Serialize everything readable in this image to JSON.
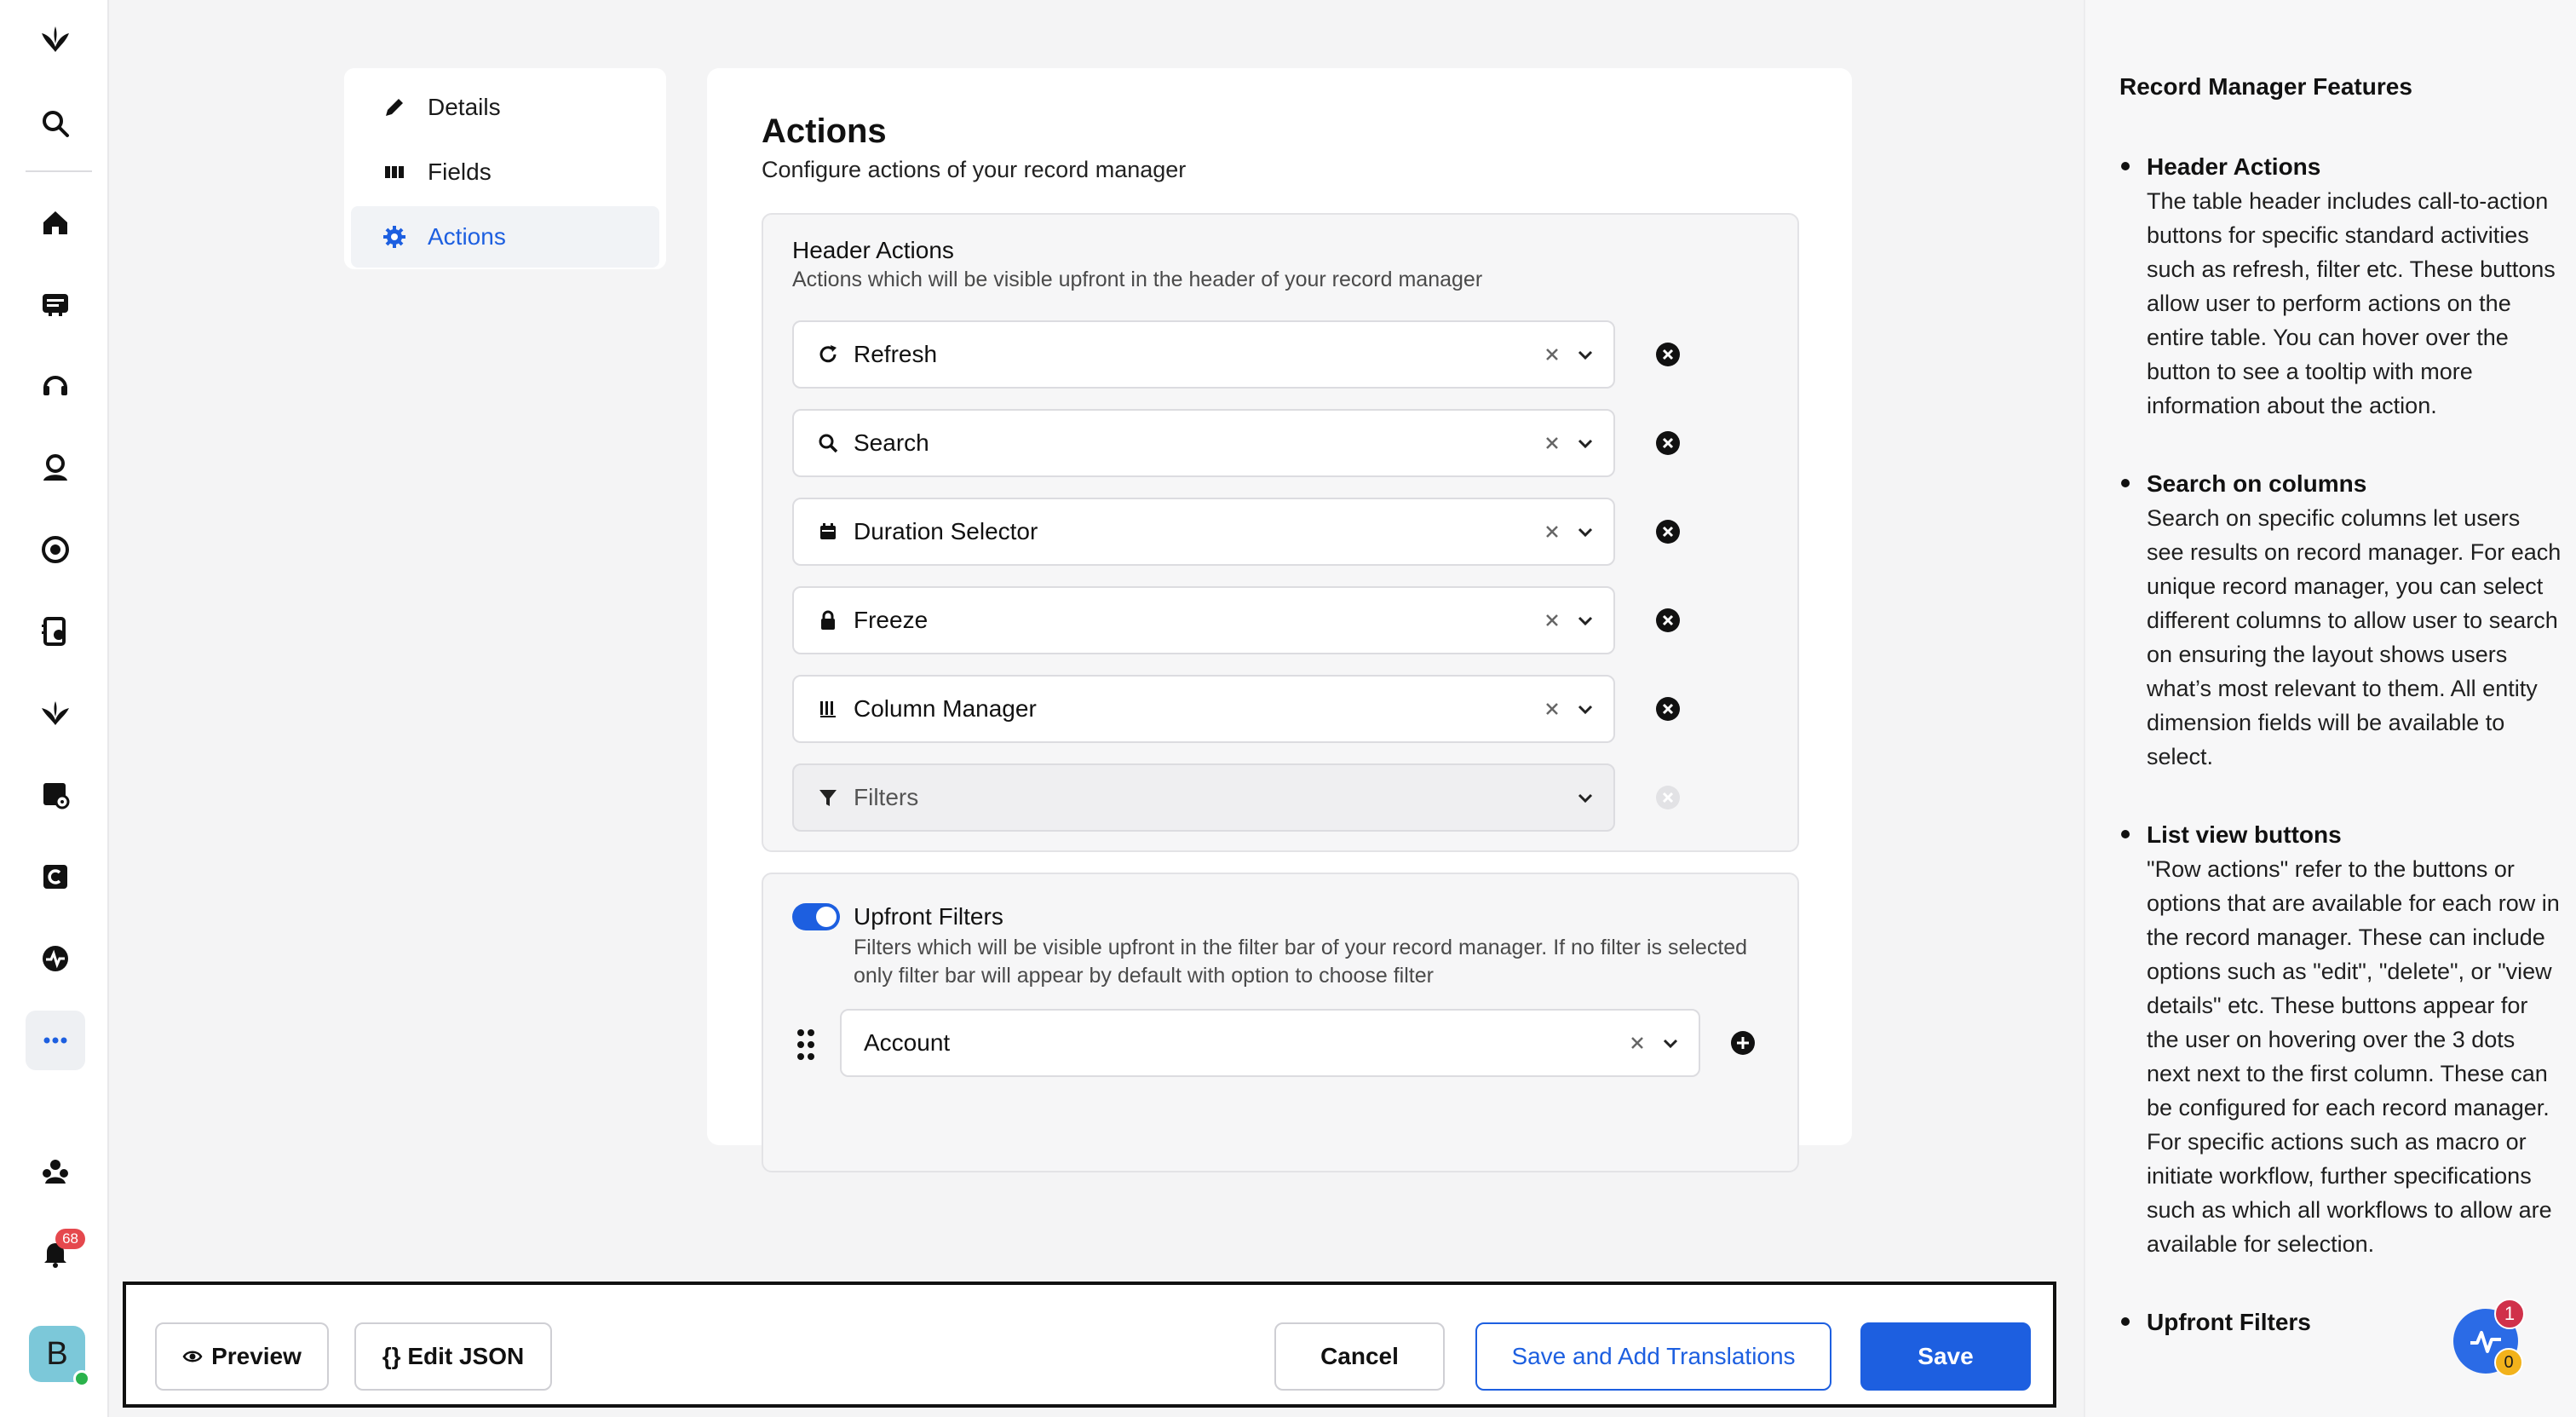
{
  "nav": {
    "items": [
      {
        "label": "Details",
        "icon": "pencil-icon"
      },
      {
        "label": "Fields",
        "icon": "columns-icon"
      },
      {
        "label": "Actions",
        "icon": "gear-icon",
        "active": true
      }
    ]
  },
  "rail": {
    "notification_count": "68",
    "avatar_letter": "B"
  },
  "main": {
    "title": "Actions",
    "subtitle": "Configure actions of your record manager",
    "header_actions": {
      "title": "Header Actions",
      "description": "Actions which will be visible upfront in the header of your record manager",
      "items": [
        {
          "label": "Refresh",
          "icon": "refresh-icon"
        },
        {
          "label": "Search",
          "icon": "search-icon"
        },
        {
          "label": "Duration Selector",
          "icon": "calendar-icon"
        },
        {
          "label": "Freeze",
          "icon": "lock-icon"
        },
        {
          "label": "Column Manager",
          "icon": "column-manager-icon"
        },
        {
          "label": "Filters",
          "icon": "filter-icon",
          "disabled": true
        }
      ]
    },
    "upfront_filters": {
      "title": "Upfront Filters",
      "enabled": true,
      "description": "Filters which will be visible upfront in the filter bar of your record manager. If no filter is selected only filter bar will appear by default with option to choose filter",
      "selected": "Account"
    }
  },
  "features": {
    "title": "Record Manager Features",
    "items": [
      {
        "title": "Header Actions",
        "body": "The table header includes call-to-action buttons for specific standard activities such as refresh, filter etc. These buttons allow user to perform actions on the entire table. You can hover over the button to see a tooltip with more information about the action."
      },
      {
        "title": "Search on columns",
        "body": "Search on specific columns let users see results on record manager. For each unique record manager, you can select different columns to allow user to search on ensuring the layout shows users what’s most relevant to them. All entity dimension fields will be available to select."
      },
      {
        "title": "List view buttons",
        "body": "\"Row actions\" refer to the buttons or options that are available for each row in the record manager. These can include options such as \"edit\", \"delete\", or \"view details\" etc. These buttons appear for the user on hovering over the 3 dots next next to the first column. These can be configured for each record manager. For specific actions such as macro or initiate workflow, further specifications such as which all workflows to allow are available for selection."
      },
      {
        "title": "Upfront Filters",
        "body": ""
      }
    ]
  },
  "widget": {
    "red_count": "1",
    "yellow_count": "0"
  },
  "footer": {
    "preview_label": "Preview",
    "edit_json_label": "{} Edit JSON",
    "cancel_label": "Cancel",
    "save_translations_label": "Save and Add Translations",
    "save_label": "Save"
  },
  "colors": {
    "primary": "#1d5fe0",
    "background": "#f4f4f5",
    "danger_badge": "#e5484d"
  }
}
